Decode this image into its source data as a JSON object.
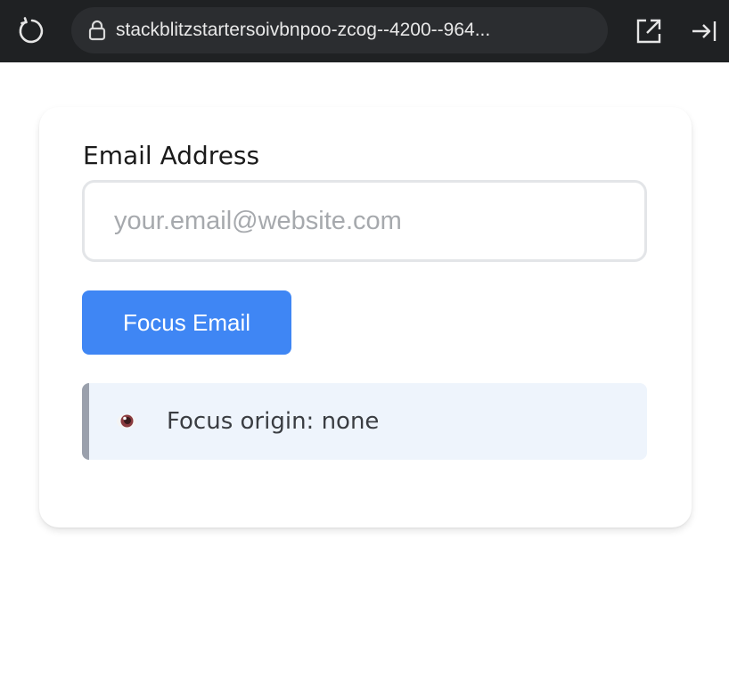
{
  "browser": {
    "url": "stackblitzstartersoivbnpoo-zcog--4200--964...",
    "icons": {
      "reload": "reload-icon",
      "lock": "lock-icon",
      "open_new_tab": "open-in-new-tab-icon",
      "collapse": "collapse-panel-icon"
    },
    "colors": {
      "bar": "#1f2123",
      "urlbar": "#2b2d30"
    }
  },
  "form": {
    "email_label": "Email Address",
    "email_placeholder": "your.email@website.com",
    "email_value": "",
    "focus_button_label": "Focus Email",
    "status_text": "Focus origin: none",
    "status_icon": "eye-icon",
    "colors": {
      "button": "#3f86f4",
      "status_background": "#eef4fc",
      "status_accent": "#9aa0ac"
    }
  }
}
